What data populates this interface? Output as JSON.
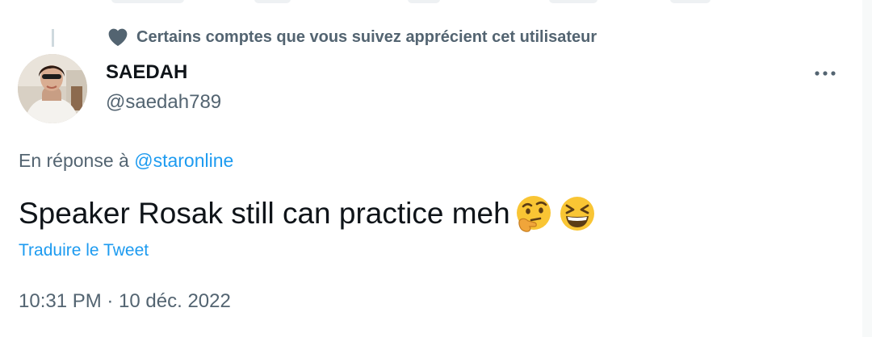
{
  "social_context": {
    "text": "Certains comptes que vous suivez apprécient cet utilisateur",
    "icon": "heart-icon"
  },
  "author": {
    "display_name": "SAEDAH",
    "handle": "@saedah789"
  },
  "reply": {
    "prefix": "En réponse à ",
    "mention": "@staronline"
  },
  "tweet": {
    "text": "Speaker Rosak still can practice meh",
    "emojis": [
      "thinking-face-emoji",
      "grinning-squinting-face-emoji"
    ]
  },
  "translate_label": "Traduire le Tweet",
  "timestamp": "10:31 PM · 10 déc. 2022",
  "colors": {
    "accent": "#1d9bf0",
    "secondary_text": "#536471",
    "primary_text": "#0f1419"
  }
}
